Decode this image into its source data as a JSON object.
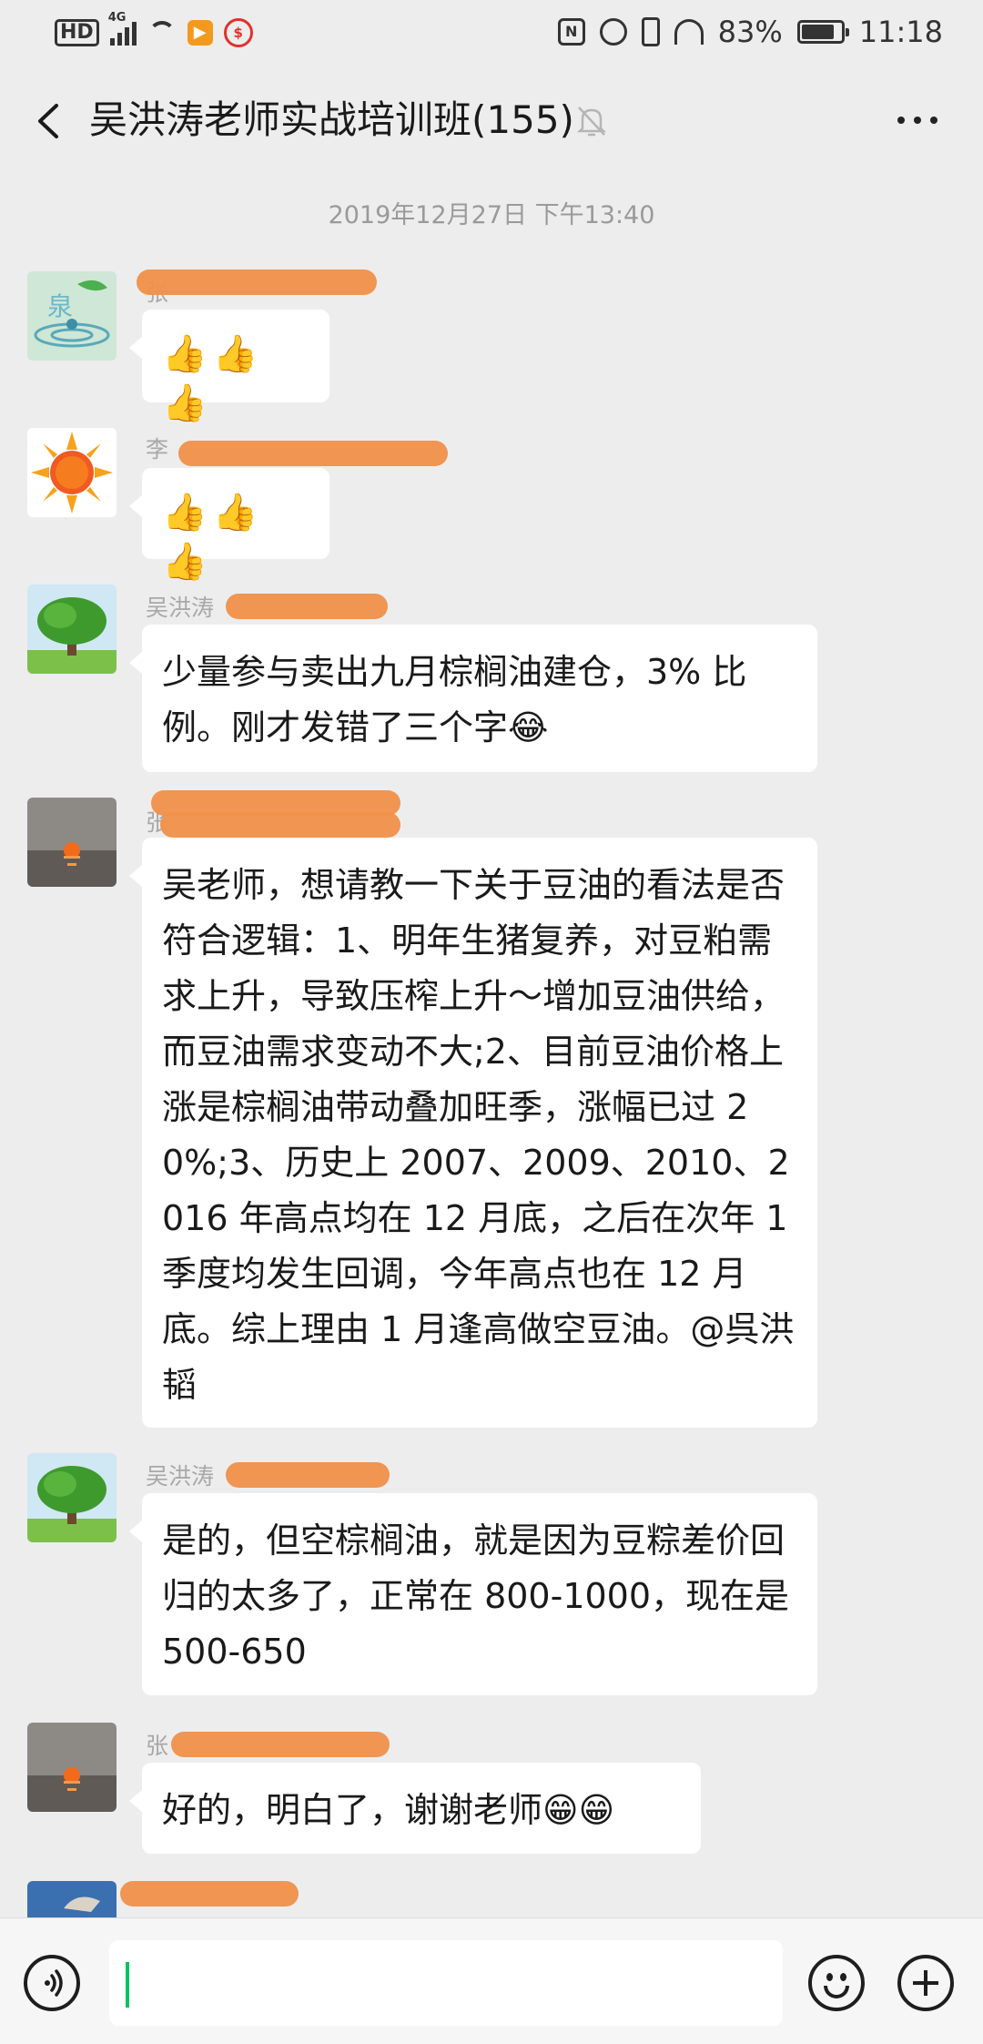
{
  "status_bar": {
    "network_label": "HD",
    "signal_label": "4G",
    "battery_percent": "83%",
    "time": "11:18",
    "nfc_icon": "N"
  },
  "header": {
    "title": "吴洪涛老师实战培训班(155)"
  },
  "chat": {
    "timestamp": "2019年12月27日 下午13:40",
    "messages": [
      {
        "sender": "张",
        "text": "👍👍👍"
      },
      {
        "sender": "李",
        "text": "👍👍👍"
      },
      {
        "sender": "吴洪涛",
        "text": "少量参与卖出九月棕榈油建仓，3% 比例。刚才发错了三个字😂"
      },
      {
        "sender": "张",
        "text": "吴老师，想请教一下关于豆油的看法是否符合逻辑：1、明年生猪复养，对豆粕需求上升，导致压榨上升～增加豆油供给，而豆油需求变动不大;2、目前豆油价格上涨是棕榈油带动叠加旺季，涨幅已过 20%;3、历史上 2007、2009、2010、2016 年高点均在 12 月底，之后在次年 1 季度均发生回调，今年高点也在 12 月底。综上理由 1 月逢高做空豆油。@呉洪韬"
      },
      {
        "sender": "吴洪涛",
        "text": "是的，但空棕榈油，就是因为豆粽差价回归的太多了，正常在 800-1000，现在是 500-650"
      },
      {
        "sender": "张",
        "text": "好的，明白了，谢谢老师😁😁"
      }
    ]
  },
  "colors": {
    "background": "#ededed",
    "bubble": "#ffffff",
    "redaction": "#f0904a",
    "caret": "#07c160"
  }
}
